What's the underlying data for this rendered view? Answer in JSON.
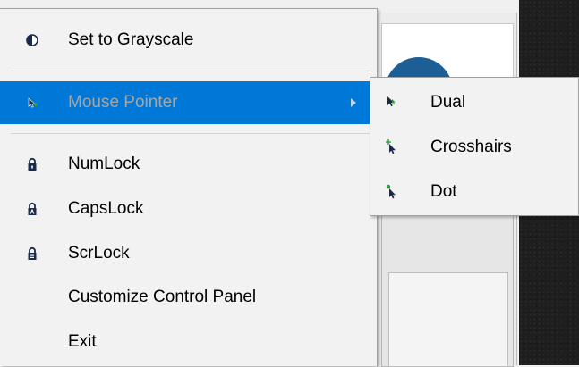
{
  "menu": {
    "items": [
      {
        "label": "Set to Grayscale",
        "icon": "contrast-icon"
      },
      {
        "label": "Mouse Pointer",
        "icon": "cursor-arrow-icon",
        "has_submenu": true,
        "state": "disabled-highlighted"
      },
      {
        "label": "NumLock",
        "icon": "lock-icon"
      },
      {
        "label": "CapsLock",
        "icon": "lock-icon"
      },
      {
        "label": "ScrLock",
        "icon": "lock-icon"
      },
      {
        "label": "Customize Control Panel"
      },
      {
        "label": "Exit"
      }
    ]
  },
  "submenu": {
    "items": [
      {
        "label": "Dual",
        "icon": "dual-pointer-icon"
      },
      {
        "label": "Crosshairs",
        "icon": "crosshairs-pointer-icon"
      },
      {
        "label": "Dot",
        "icon": "dot-pointer-icon"
      }
    ]
  },
  "colors": {
    "highlight": "#0078d7",
    "menu_background": "#f2f2f2",
    "disabled_text": "#a6a6a6",
    "pointer_green": "#2e9c3a",
    "pointer_navy": "#1a2a4a"
  }
}
